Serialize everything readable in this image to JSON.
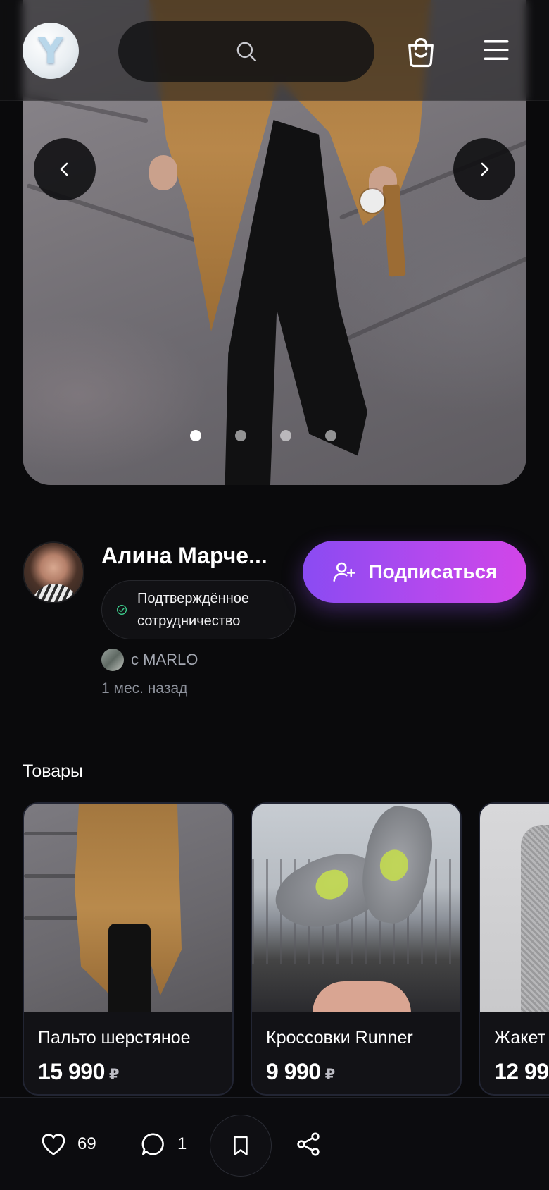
{
  "header": {
    "logo_letter": "Y",
    "search_placeholder": "",
    "icons": {
      "search": "search-icon",
      "cart": "shopping-bag-icon",
      "menu": "hamburger-menu-icon"
    }
  },
  "carousel": {
    "slides_total": 4,
    "active_slide": 1,
    "prev_icon": "chevron-left-icon",
    "next_icon": "chevron-right-icon"
  },
  "author": {
    "name": "Алина Марче...",
    "verified_label_line1": "Подтверждённое",
    "verified_label_line2": "сотрудничество",
    "brand_text": "с MARLO",
    "time_ago": "1 мес. назад",
    "subscribe_label": "Подписаться"
  },
  "products": {
    "section_title": "Товары",
    "items": [
      {
        "name": "Пальто шерстяное",
        "price": "15 990",
        "currency": "₽"
      },
      {
        "name": "Кроссовки Runner",
        "price": "9 990",
        "currency": "₽"
      },
      {
        "name": "Жакет",
        "price": "12 99",
        "currency": ""
      }
    ]
  },
  "actions": {
    "likes": "69",
    "comments": "1"
  },
  "colors": {
    "background": "#0a0a0c",
    "accent_gradient_start": "#8a4bf2",
    "accent_gradient_end": "#d246e8",
    "verified_green": "#3ecf8e"
  }
}
